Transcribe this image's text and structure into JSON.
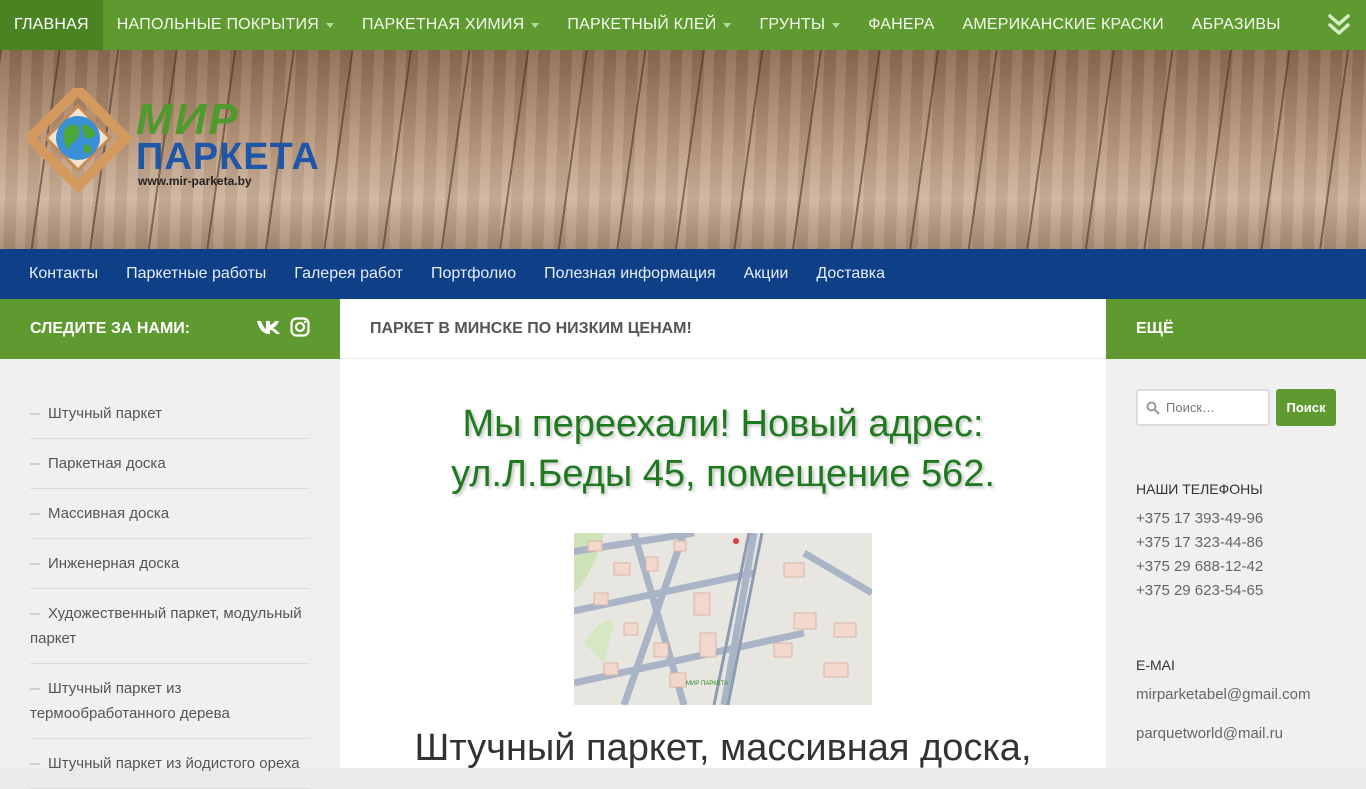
{
  "top_nav": {
    "items": [
      {
        "label": "ГЛАВНАЯ",
        "dropdown": false,
        "active": true
      },
      {
        "label": "НАПОЛЬНЫЕ ПОКРЫТИЯ",
        "dropdown": true
      },
      {
        "label": "ПАРКЕТНАЯ ХИМИЯ",
        "dropdown": true
      },
      {
        "label": "ПАРКЕТНЫЙ КЛЕЙ",
        "dropdown": true
      },
      {
        "label": "ГРУНТЫ",
        "dropdown": true
      },
      {
        "label": "ФАНЕРА",
        "dropdown": false
      },
      {
        "label": "АМЕРИКАНСКИЕ КРАСКИ",
        "dropdown": false
      },
      {
        "label": "АБРАЗИВЫ",
        "dropdown": false
      }
    ],
    "more_icon": "double-chevron-down-icon"
  },
  "header": {
    "logo_line1": "МИР",
    "logo_line2": "ПАРКЕТА",
    "logo_url": "www.mir-parketa.by"
  },
  "sub_nav": {
    "items": [
      "Контакты",
      "Паркетные работы",
      "Галерея работ",
      "Портфолио",
      "Полезная информация",
      "Акции",
      "Доставка"
    ]
  },
  "left_sidebar": {
    "title": "СЛЕДИТЕ ЗА НАМИ:",
    "social_icons": [
      "vk-icon",
      "instagram-icon"
    ],
    "items": [
      "Штучный паркет",
      "Паркетная доска",
      "Массивная доска",
      "Инженерная доска",
      "Художественный паркет, модульный паркет",
      "Штучный паркет из термообработанного дерева",
      "Штучный паркет из йодистого ореха"
    ]
  },
  "main": {
    "heading": "ПАРКЕТ В МИНСКЕ ПО НИЗКИМ ЦЕНАМ!",
    "notice_line1": "Мы переехали! Новый адрес:",
    "notice_line2": "ул.Л.Беды 45, помещение 562.",
    "map_label": "МИР ПАРКЕТА",
    "h2": "Штучный паркет, массивная доска,"
  },
  "right_sidebar": {
    "title": "ЕЩЁ",
    "search_placeholder": "Поиск…",
    "search_button": "Поиск",
    "phones_title": "НАШИ ТЕЛЕФОНЫ",
    "phones": [
      "+375 17 393-49-96",
      "+375 17 323-44-86",
      "+375 29 688-12-42",
      "+375 29 623-54-65"
    ],
    "email_title": "E-MAI",
    "emails": [
      "mirparketabel@gmail.com",
      "parquetworld@mail.ru"
    ]
  },
  "colors": {
    "green": "#5f9a31",
    "green_active": "#4a8422",
    "blue": "#0f3f86",
    "notice_green": "#1f7a1f"
  }
}
